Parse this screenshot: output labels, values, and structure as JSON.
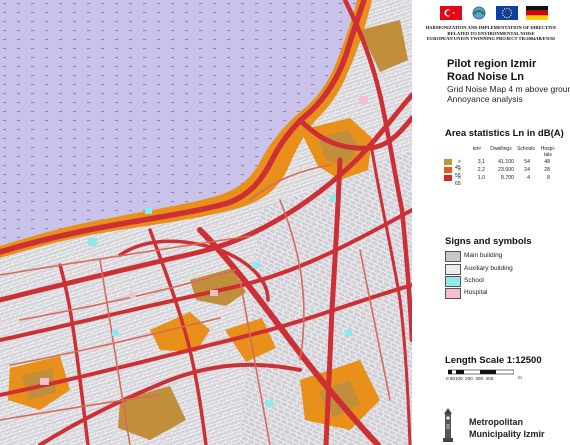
{
  "header": {
    "project_lines": [
      "HARMONIZATION AND IMPLEMENTATION OF DIRECTIVE",
      "RELATED TO ENVIRONMENTAL NOISE",
      "EUROPEAN UNION TWINNING PROJECT TR/2004/IB/EN/02"
    ],
    "flags": [
      "turkey-flag",
      "ministry-logo",
      "eu-flag",
      "germany-flag"
    ]
  },
  "title": {
    "line1": "Pilot region Izmir",
    "line2": "Road Noise Ln",
    "line3": "Grid Noise Map 4 m above ground",
    "line4": "Annoyance analysis"
  },
  "area_stats": {
    "heading": "Area statistics Ln in dB(A)",
    "columns": [
      "km²",
      "Dwellings",
      "Schools",
      "Hospi-tals"
    ],
    "rows": [
      {
        "label": "> 45",
        "km2": "3,1",
        "dwellings": "41.100",
        "schools": "54",
        "hospitals": "48",
        "color": "#c89238"
      },
      {
        "label": "> 55",
        "km2": "2,2",
        "dwellings": "23.000",
        "schools": "24",
        "hospitals": "28",
        "color": "#e85a12"
      },
      {
        "label": "> 65",
        "km2": "1,0",
        "dwellings": "8.700",
        "schools": "4",
        "hospitals": "8",
        "color": "#cc2a24"
      }
    ]
  },
  "signs": {
    "heading": "Signs and symbols",
    "items": [
      {
        "label": "Main building",
        "color": "#c8c8cc"
      },
      {
        "label": "Auxiliary building",
        "color": "#ededf0"
      },
      {
        "label": "School",
        "color": "#8fe8ee"
      },
      {
        "label": "Hospital",
        "color": "#f4bed0"
      }
    ]
  },
  "scale": {
    "heading": "Length Scale 1:12500",
    "ticks": "0 50100  200  300  400",
    "unit": "m"
  },
  "footer": {
    "line1": "Metropolitan",
    "line2": "Municipality Izmir"
  },
  "colors": {
    "sea": "#c9c3ea",
    "road": "#cc3034",
    "zone_orange": "#e8901a",
    "zone_brown": "#c18e3c"
  }
}
